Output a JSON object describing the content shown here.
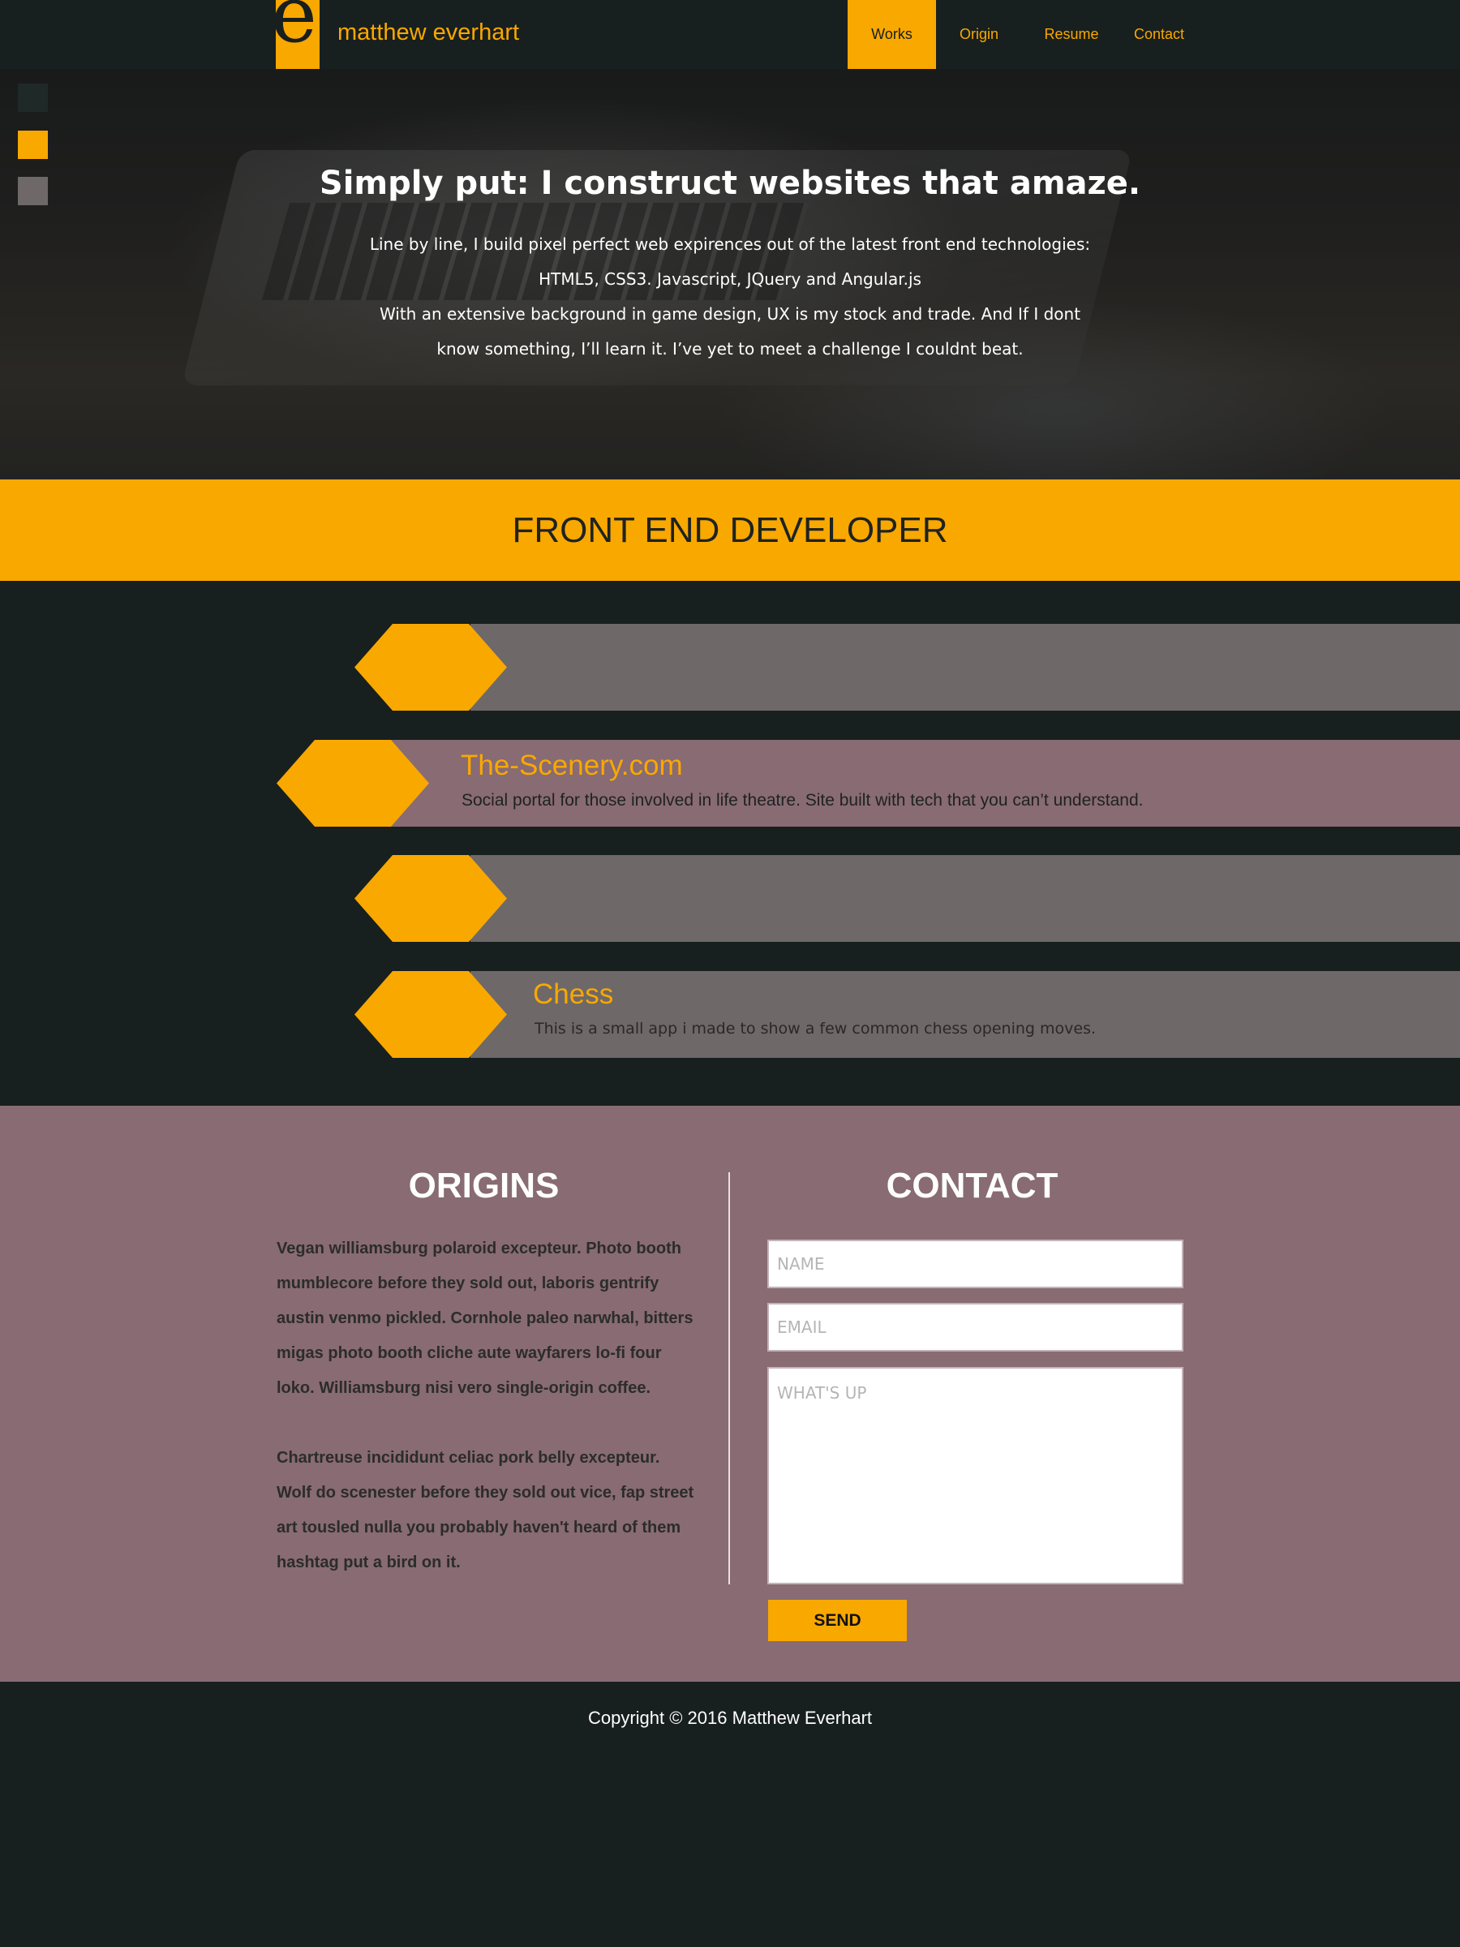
{
  "brand": {
    "logo_letter": "e",
    "name": "matthew everhart"
  },
  "nav": {
    "items": [
      {
        "label": "Works",
        "active": true
      },
      {
        "label": "Origin",
        "active": false
      },
      {
        "label": "Resume",
        "active": false
      },
      {
        "label": "Contact",
        "active": false
      }
    ]
  },
  "side_nav": {
    "colors": [
      "#1f2928",
      "#f9a800",
      "#6e6868"
    ]
  },
  "hero": {
    "title": "Simply put: I construct websites that amaze.",
    "lines": [
      "Line by line, I build pixel perfect web expirences out of the latest front end technologies:",
      "HTML5, CSS3. Javascript, JQuery and Angular.js",
      "With an extensive background in game design, UX is my stock and trade. And If I dont",
      "know something, I’ll learn it. I’ve yet to meet a challenge I couldnt beat."
    ]
  },
  "banner": {
    "title": "FRONT END DEVELOPER"
  },
  "works": [
    {
      "title": "",
      "description": ""
    },
    {
      "title": "The-Scenery.com",
      "description": "Social portal for those involved in life theatre. Site built with tech that you can’t understand."
    },
    {
      "title": "",
      "description": ""
    },
    {
      "title": "Chess",
      "description": "This is a small app i made to show a few common chess opening moves."
    }
  ],
  "origins": {
    "title": "ORIGINS",
    "paragraphs": [
      "Vegan williamsburg polaroid excepteur. Photo booth mumblecore before they sold out, laboris gentrify austin venmo pickled. Cornhole paleo narwhal, bitters migas photo booth cliche aute wayfarers lo-fi four loko. Williamsburg nisi vero single-origin coffee.",
      "Chartreuse incididunt celiac pork belly excepteur. Wolf do scenester before they sold out vice, fap street art tousled nulla you probably haven't heard of them hashtag put a bird on it."
    ]
  },
  "contact": {
    "title": "CONTACT",
    "name_placeholder": "NAME",
    "email_placeholder": "EMAIL",
    "message_placeholder": "WHAT'S UP",
    "send_label": "SEND"
  },
  "footer": {
    "copyright": "Copyright © 2016 Matthew Everhart"
  },
  "colors": {
    "accent": "#f9a800",
    "dark": "#181f1f",
    "mauve": "#886b73",
    "bar_grey": "#6e6868"
  }
}
